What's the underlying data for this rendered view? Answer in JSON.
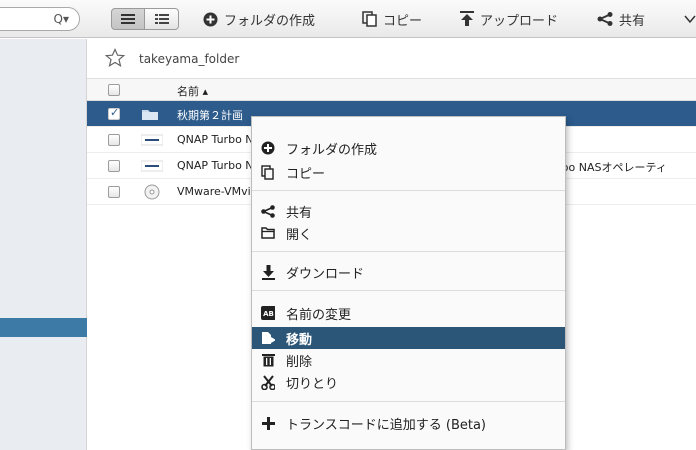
{
  "toolbar": {
    "search_icon": "search-icon",
    "create_folder": "フォルダの作成",
    "copy": "コピー",
    "upload": "アップロード",
    "share": "共有"
  },
  "breadcrumb": {
    "folder": "takeyama_folder"
  },
  "table": {
    "header_name": "名前 ▴",
    "rows": [
      {
        "name": "秋期第２計画",
        "extra": "",
        "checked": true,
        "icon": "folder-icon"
      },
      {
        "name": "QNAP Turbo N",
        "extra": "",
        "checked": false,
        "icon": "qnap-file-icon"
      },
      {
        "name": "QNAP Turbo N",
        "extra": "Turbo NASオペレーティ",
        "checked": false,
        "icon": "qnap-file-icon"
      },
      {
        "name": "VMware-VMvi",
        "extra": "",
        "checked": false,
        "icon": "disc-icon"
      }
    ]
  },
  "context_menu": {
    "create_folder": "フォルダの作成",
    "copy": "コピー",
    "share": "共有",
    "open": "開く",
    "download": "ダウンロード",
    "rename": "名前の変更",
    "move": "移動",
    "delete": "削除",
    "cut": "切りとり",
    "transcode": "トランスコードに追加する (Beta)"
  },
  "colors": {
    "selected_row": "#2c5b8c",
    "highlight": "#2b5677",
    "sidebar_sel": "#3d7aa6"
  }
}
